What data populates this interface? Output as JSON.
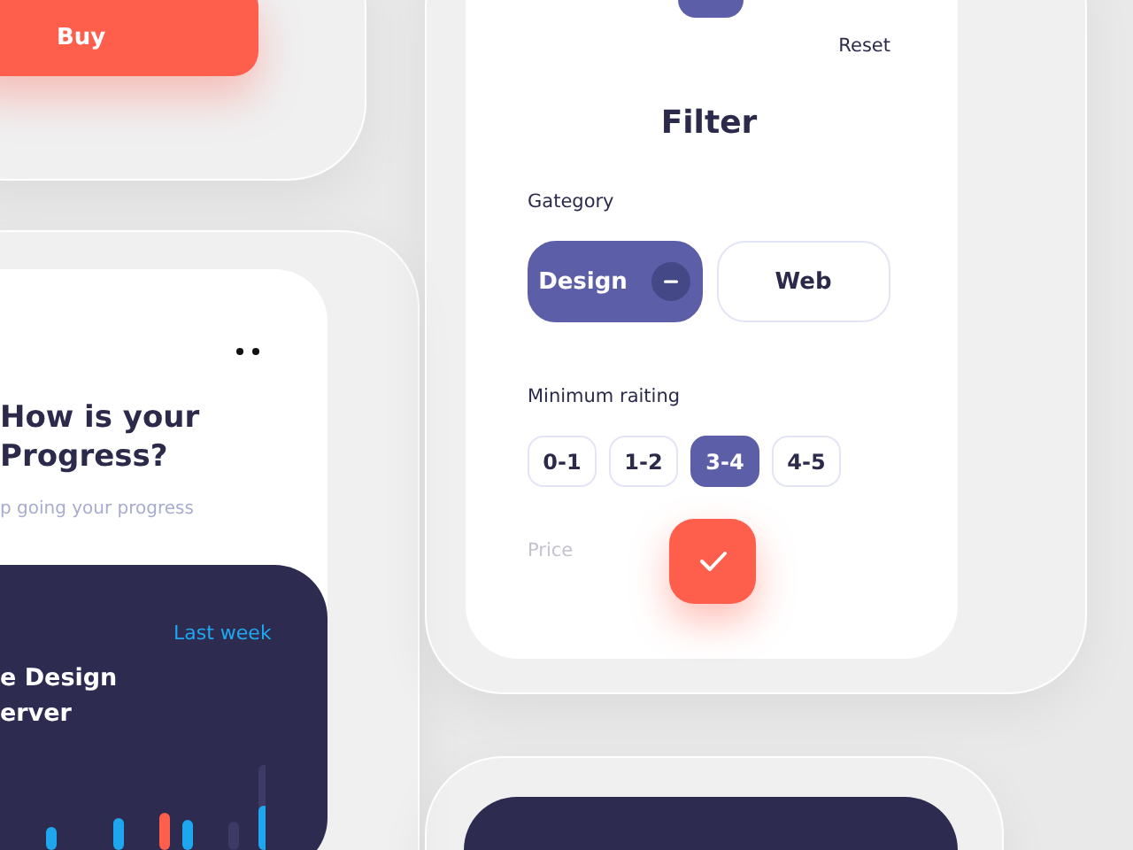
{
  "buy_screen": {
    "buy_button": "Buy"
  },
  "progress_screen": {
    "title": "How is your Progress?",
    "subtitle": "p going your progress",
    "card": {
      "period_link": "Last week",
      "course": "e Design erver"
    }
  },
  "filter_screen": {
    "reset": "Reset",
    "title": "Filter",
    "category_label": "Gategory",
    "categories": [
      {
        "label": "Design",
        "selected": true
      },
      {
        "label": "Web",
        "selected": false
      }
    ],
    "rating_label": "Minimum raiting",
    "ratings": [
      {
        "label": "0-1",
        "selected": false
      },
      {
        "label": "1-2",
        "selected": false
      },
      {
        "label": "3-4",
        "selected": true
      },
      {
        "label": "4-5",
        "selected": false
      }
    ],
    "price_label": "Price"
  }
}
